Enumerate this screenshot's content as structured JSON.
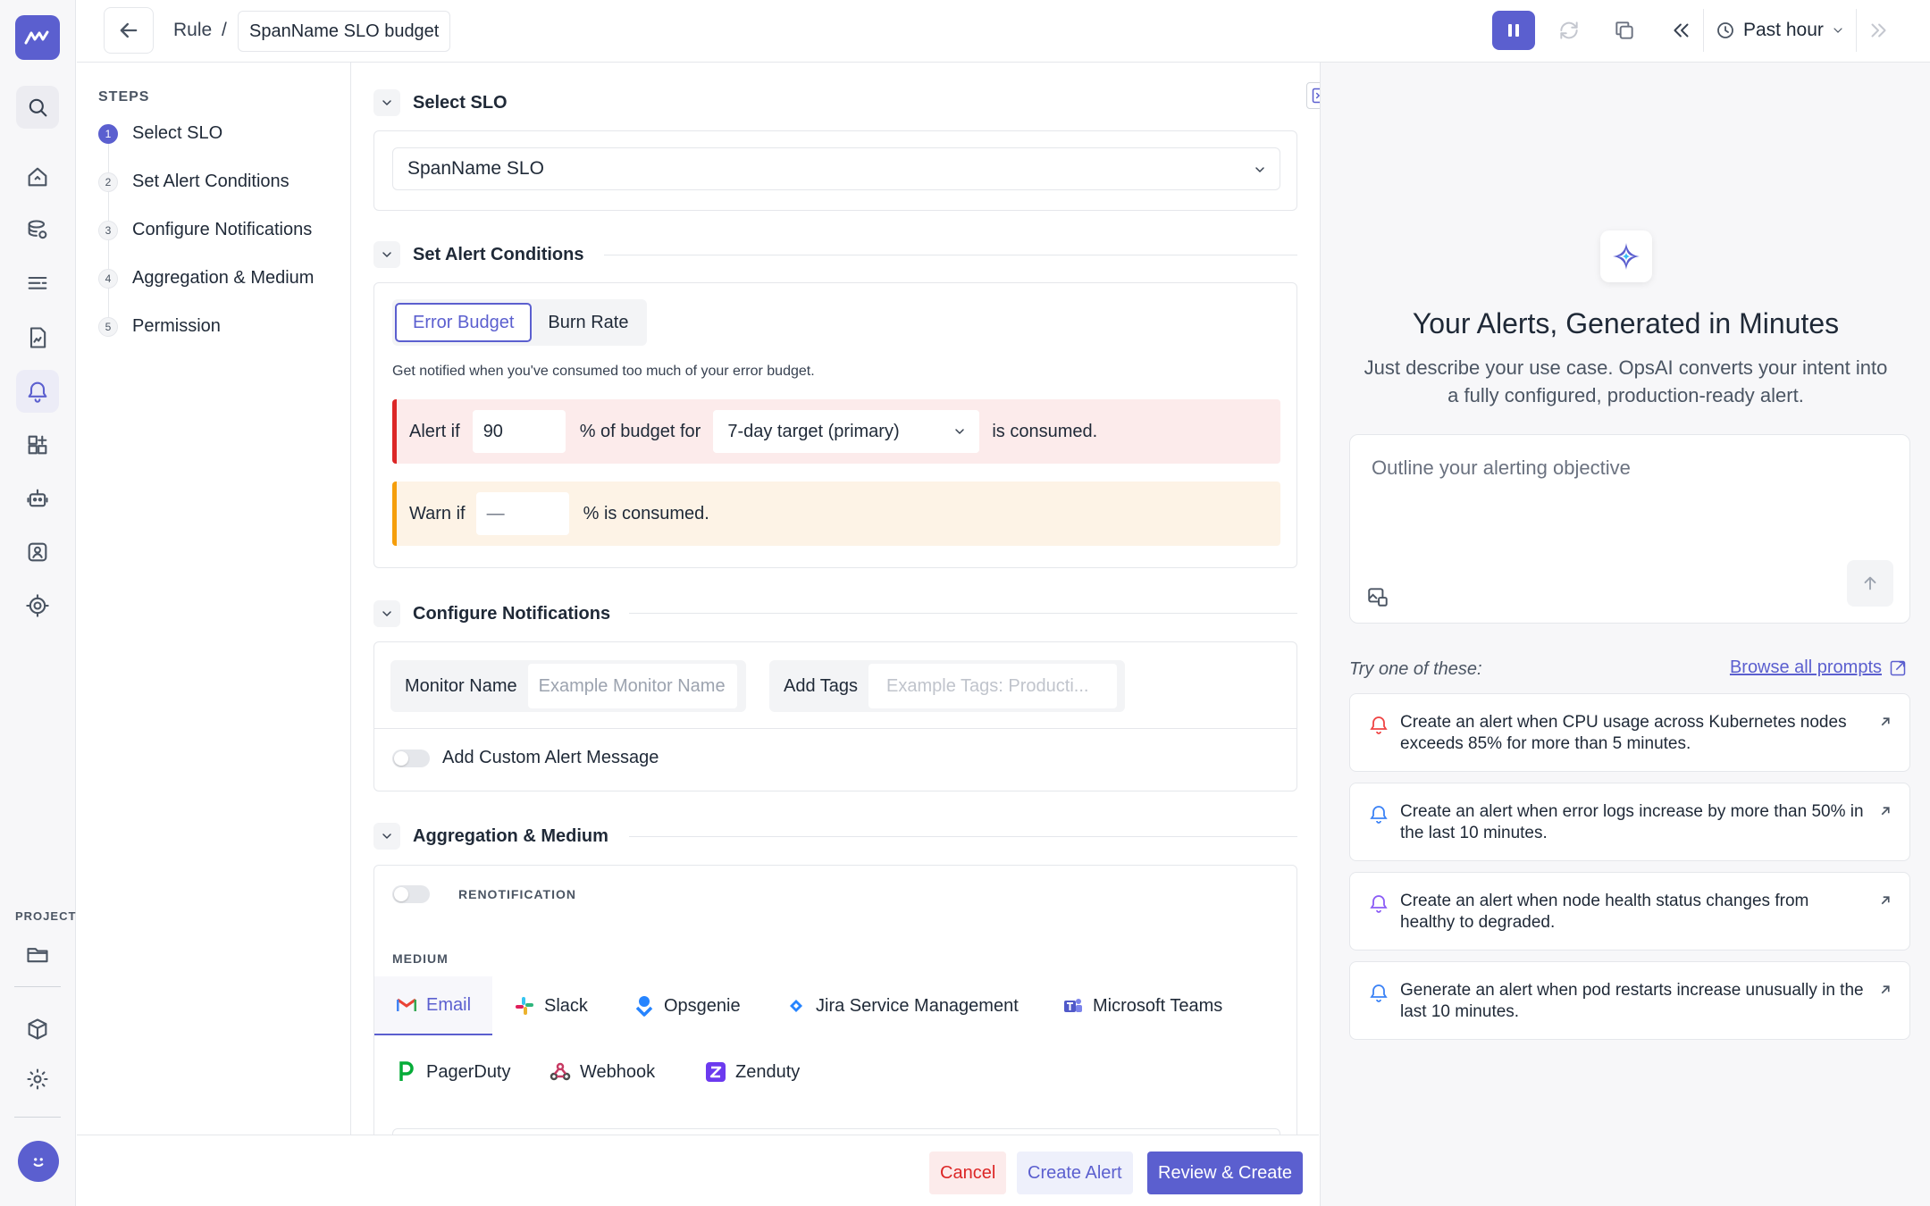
{
  "breadcrumb": {
    "rule": "Rule",
    "separator": "/",
    "current": "SpanName SLO budget"
  },
  "toolbar": {
    "time_range": "Past hour"
  },
  "steps": {
    "header": "STEPS",
    "items": [
      {
        "num": "1",
        "label": "Select SLO"
      },
      {
        "num": "2",
        "label": "Set Alert Conditions"
      },
      {
        "num": "3",
        "label": "Configure Notifications"
      },
      {
        "num": "4",
        "label": "Aggregation & Medium"
      },
      {
        "num": "5",
        "label": "Permission"
      }
    ]
  },
  "rail": {
    "project_label": "PROJECT"
  },
  "select_slo": {
    "title": "Select SLO",
    "value": "SpanName SLO"
  },
  "alert_conditions": {
    "title": "Set Alert Conditions",
    "tab_error_budget": "Error Budget",
    "tab_burn_rate": "Burn Rate",
    "hint": "Get notified when you've consumed too much of your error budget.",
    "alert_prefix": "Alert if",
    "alert_value": "90",
    "alert_mid": "% of budget for",
    "target_select": "7-day target (primary)",
    "alert_suffix": "is consumed.",
    "warn_prefix": "Warn if",
    "warn_value": "—",
    "warn_suffix": "% is consumed."
  },
  "notifications": {
    "title": "Configure Notifications",
    "monitor_label": "Monitor Name",
    "monitor_placeholder": "Example Monitor Name",
    "tags_label": "Add Tags",
    "tags_placeholder": "Example Tags: Producti...",
    "custom_message": "Add Custom Alert Message"
  },
  "aggregation": {
    "title": "Aggregation & Medium",
    "renotification": "RENOTIFICATION",
    "medium_label": "MEDIUM",
    "mediums": [
      "Email",
      "Slack",
      "Opsgenie",
      "Jira Service Management",
      "Microsoft Teams",
      "PagerDuty",
      "Webhook",
      "Zenduty"
    ]
  },
  "footer": {
    "cancel": "Cancel",
    "create": "Create Alert",
    "review": "Review & Create"
  },
  "ai": {
    "title": "Your Alerts, Generated in Minutes",
    "subtitle": "Just describe your use case. OpsAI converts your intent into a fully configured, production-ready alert.",
    "placeholder": "Outline your alerting objective",
    "try_label": "Try one of these:",
    "browse": "Browse all prompts",
    "suggestions": [
      "Create an alert when CPU usage across Kubernetes nodes exceeds 85% for more than 5 minutes.",
      "Create an alert when error logs increase by more than 50% in the last 10 minutes.",
      "Create an alert when node health status changes from healthy to degraded.",
      "Generate an alert when pod restarts increase unusually in the last 10 minutes."
    ]
  },
  "colors": {
    "accent": "#5b5fcf",
    "danger": "#dc2626",
    "warning": "#f59e0b"
  }
}
